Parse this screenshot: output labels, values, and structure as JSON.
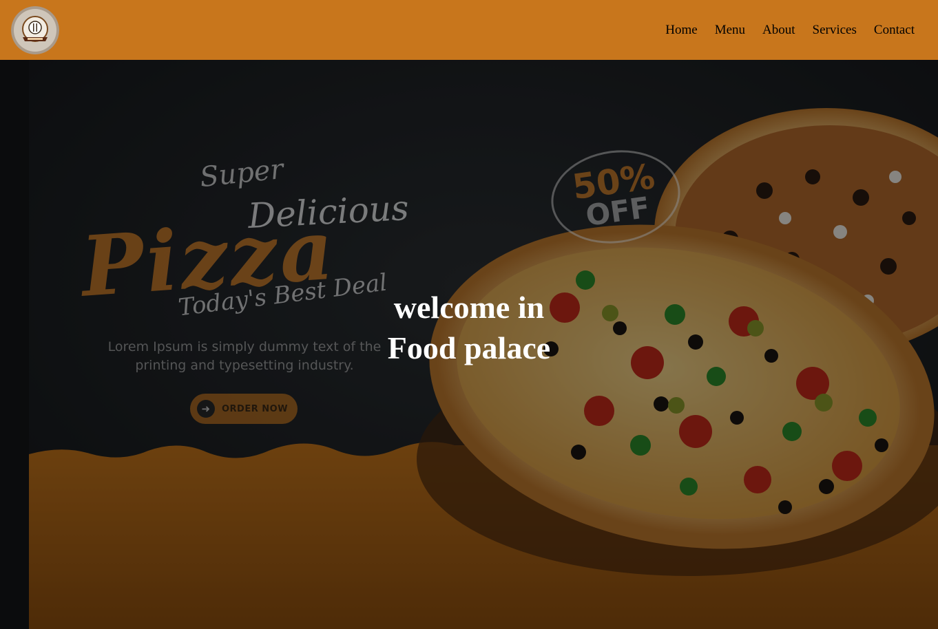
{
  "header": {
    "logo_icon": "restaurant-logo-icon",
    "nav": [
      {
        "label": "Home"
      },
      {
        "label": "Menu"
      },
      {
        "label": "About"
      },
      {
        "label": "Services"
      },
      {
        "label": "Contact"
      }
    ],
    "background_color": "#c8761c"
  },
  "hero": {
    "banner": {
      "line_super": "Super",
      "line_delicious": "Delicious",
      "line_pizza": "Pizza",
      "line_deal": "Today's Best Deal",
      "description": "Lorem Ipsum is simply dummy text of the printing and typesetting industry.",
      "order_button": "ORDER NOW",
      "discount_percent": "50%",
      "discount_off": "OFF"
    },
    "welcome_line1": "welcome in",
    "welcome_line2": "Food palace"
  }
}
